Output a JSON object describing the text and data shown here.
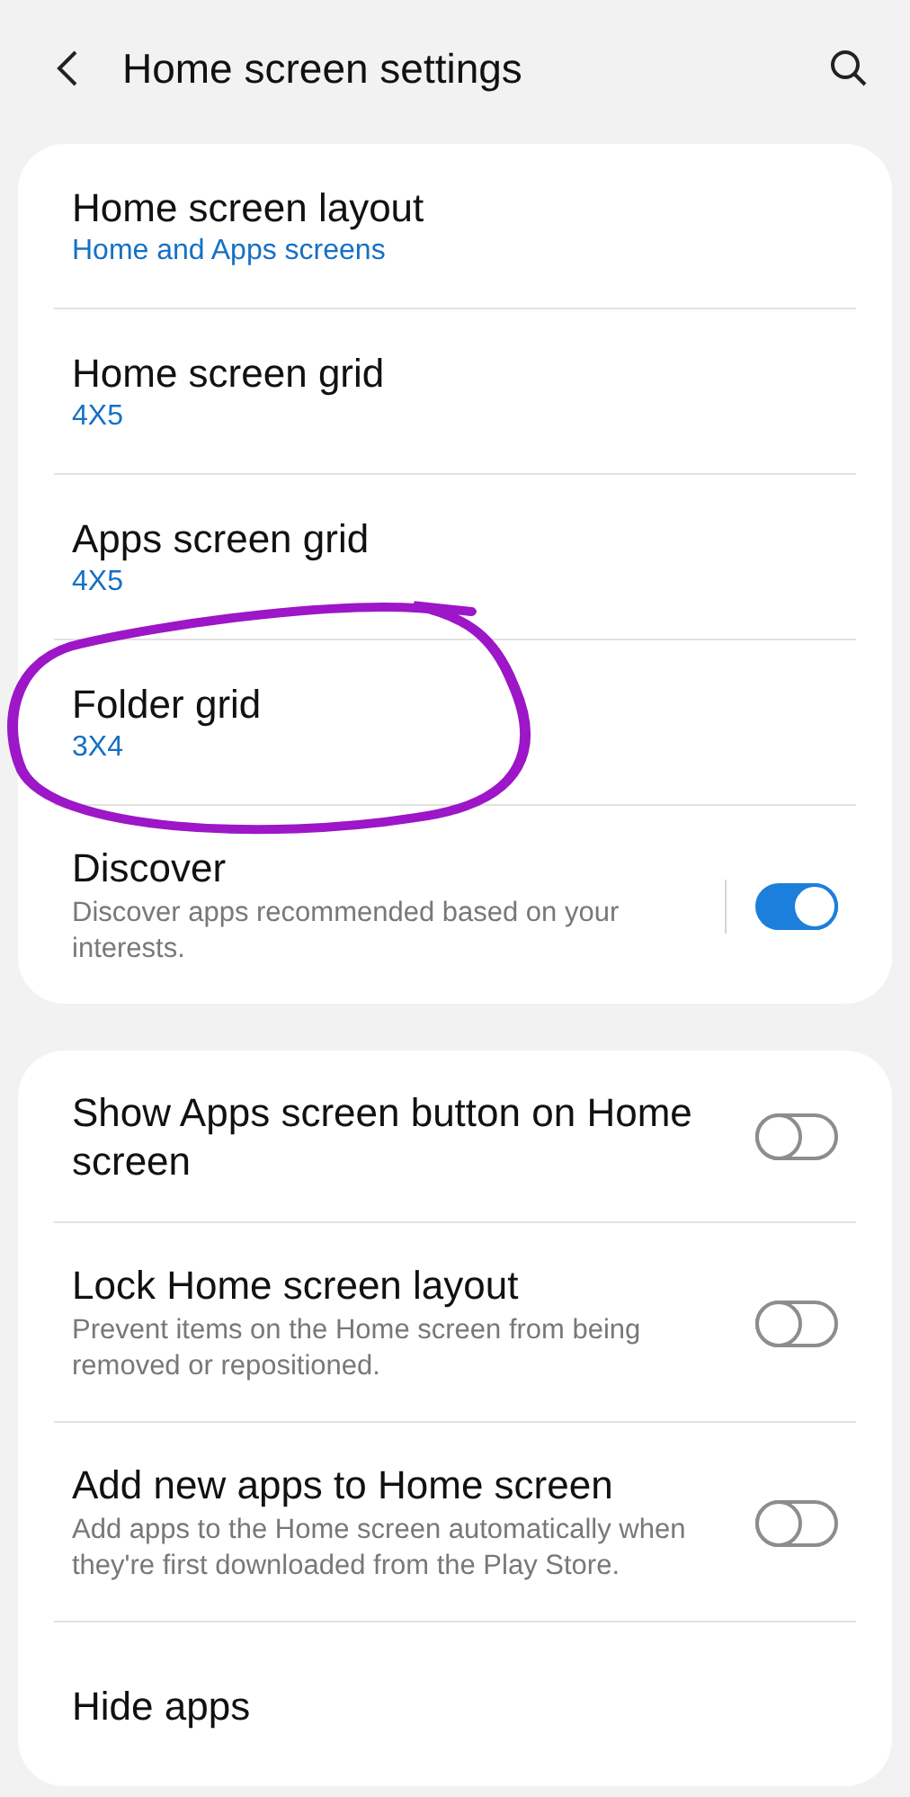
{
  "header": {
    "title": "Home screen settings"
  },
  "sections": [
    {
      "items": [
        {
          "kind": "link",
          "title": "Home screen layout",
          "value": "Home and Apps screens"
        },
        {
          "kind": "link",
          "title": "Home screen grid",
          "value": "4X5"
        },
        {
          "kind": "link",
          "title": "Apps screen grid",
          "value": "4X5"
        },
        {
          "kind": "link",
          "title": "Folder grid",
          "value": "3X4"
        },
        {
          "kind": "split_switch",
          "title": "Discover",
          "description": "Discover apps recommended based on your interests.",
          "on": true
        }
      ]
    },
    {
      "items": [
        {
          "kind": "switch",
          "title": "Show Apps screen button on Home screen",
          "on": false
        },
        {
          "kind": "switch",
          "title": "Lock Home screen layout",
          "description": "Prevent items on the Home screen from being removed or repositioned.",
          "on": false
        },
        {
          "kind": "switch",
          "title": "Add new apps to Home screen",
          "description": "Add apps to the Home screen automatically when they're first downloaded from the Play Store.",
          "on": false
        },
        {
          "kind": "link",
          "title": "Hide apps"
        }
      ]
    }
  ]
}
